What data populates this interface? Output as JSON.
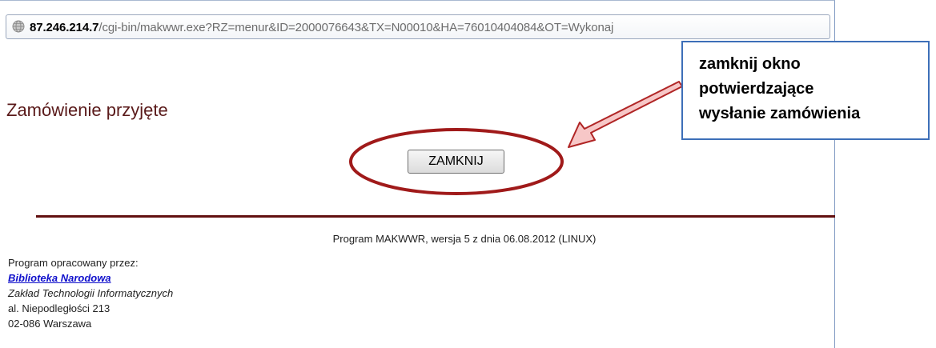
{
  "address_bar": {
    "host": "87.246.214.7",
    "path": "/cgi-bin/makwwr.exe?RZ=menur&ID=2000076643&TX=N00010&HA=76010404084&OT=Wykonaj",
    "icon": "globe-icon"
  },
  "page": {
    "title": "Zamówienie przyjęte",
    "close_button_label": "ZAMKNIJ"
  },
  "footer": {
    "program": "Program MAKWWR, wersja 5 z dnia 06.08.2012 (LINUX)",
    "prepared_by": "Program opracowany przez:",
    "library_link": "Biblioteka Narodowa",
    "department": "Zakład Technologii Informatycznych",
    "street": "al. Niepodległości 213",
    "city": "02-086 Warszawa"
  },
  "annotation": {
    "lines": [
      "zamknij okno",
      "potwierdzające",
      "wysłanie zamówienia"
    ],
    "colors": {
      "ellipse": "#a01a1a",
      "arrow_fill": "#f7c7c7",
      "arrow_stroke": "#b02525",
      "callout_border": "#3d6fb8"
    }
  },
  "colors": {
    "title": "#5a1a1a",
    "divider": "#621010",
    "link": "#1010cc"
  }
}
